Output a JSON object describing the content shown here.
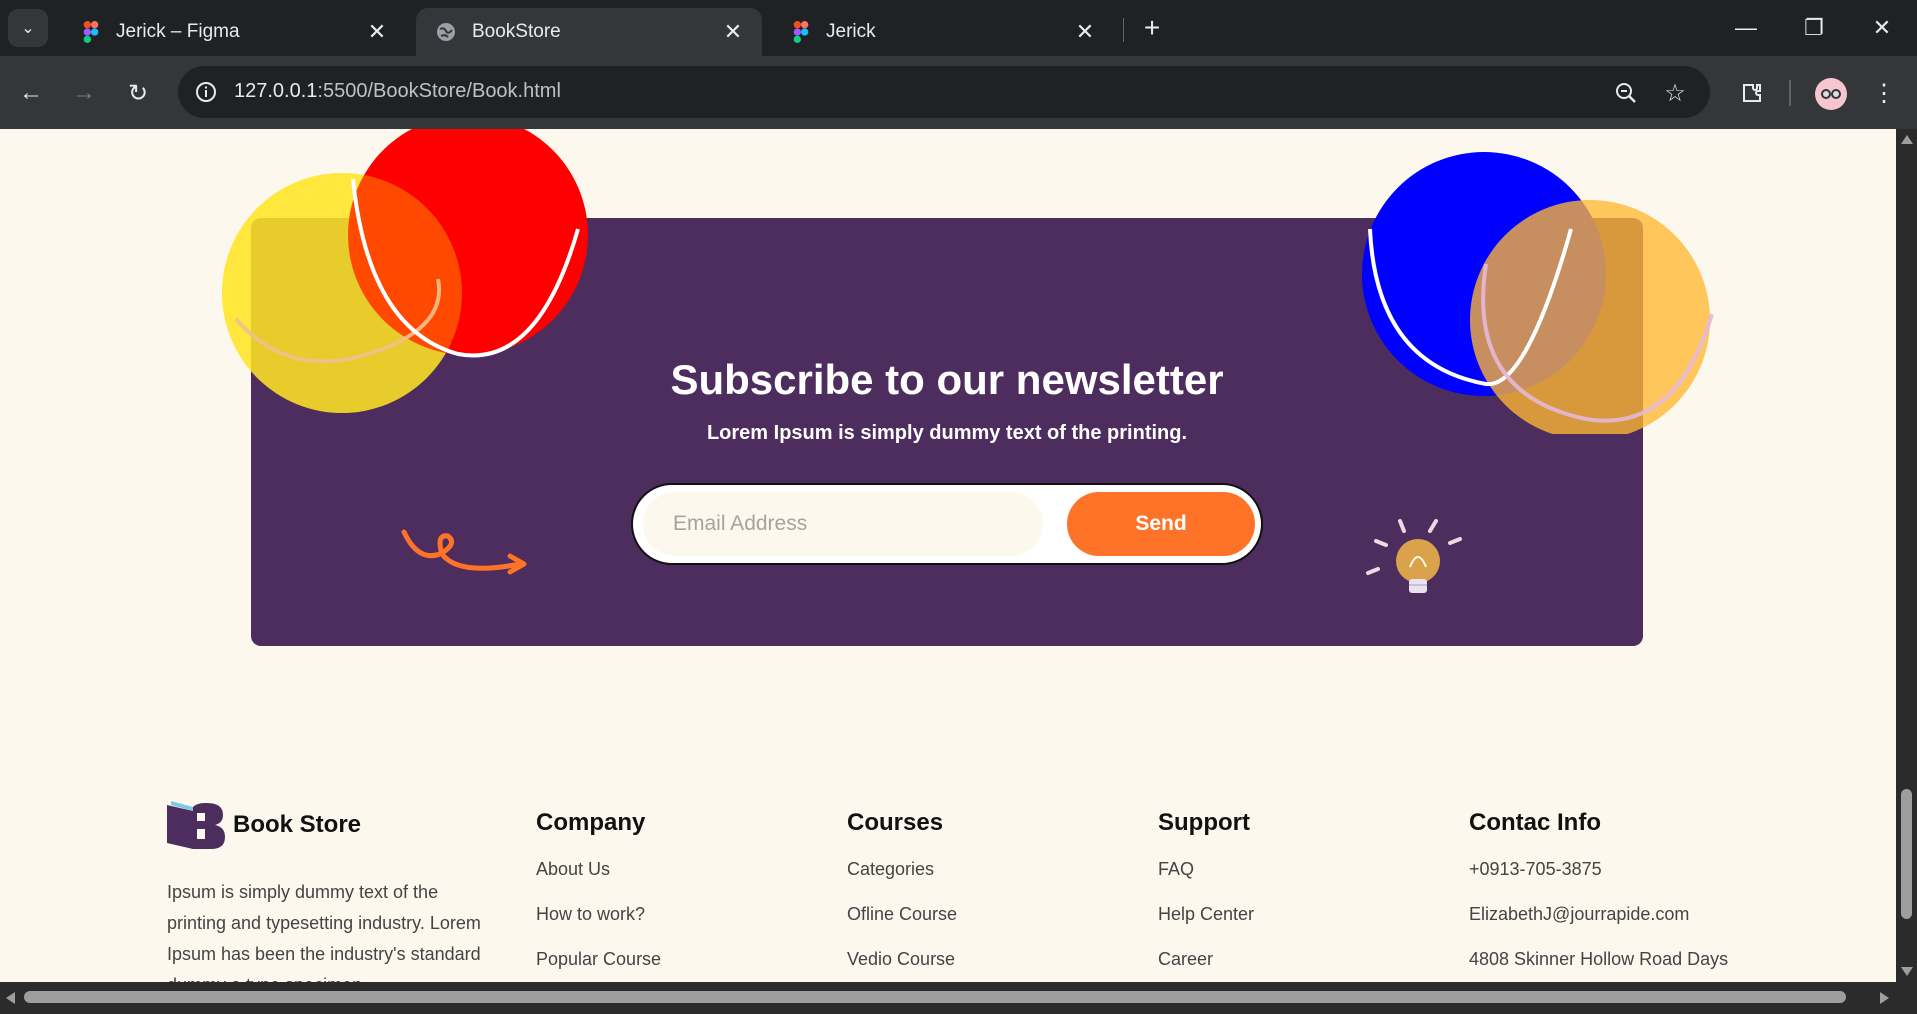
{
  "browser": {
    "tabs": [
      {
        "title": "Jerick – Figma",
        "icon": "figma-icon",
        "active": false
      },
      {
        "title": "BookStore",
        "icon": "globe-icon",
        "active": true
      },
      {
        "title": "Jerick",
        "icon": "figma-icon",
        "active": false
      }
    ],
    "url_host": "127.0.0.1",
    "url_path": ":5500/BookStore/Book.html"
  },
  "newsletter": {
    "title": "Subscribe to our newsletter",
    "subtitle": "Lorem Ipsum is simply dummy text of the printing.",
    "email_placeholder": "Email Address",
    "email_value": "",
    "send_label": "Send"
  },
  "footer": {
    "brand": {
      "name": "Book Store",
      "description": "Ipsum is simply dummy text of the printing and typesetting industry. Lorem Ipsum has been the industry's standard dummy a type specimen"
    },
    "columns": [
      {
        "heading": "Company",
        "links": [
          "About Us",
          "How to work?",
          "Popular Course"
        ]
      },
      {
        "heading": "Courses",
        "links": [
          "Categories",
          "Ofline Course",
          "Vedio Course"
        ]
      },
      {
        "heading": "Support",
        "links": [
          "FAQ",
          "Help Center",
          "Career"
        ]
      },
      {
        "heading": "Contac Info",
        "links": [
          "+0913-705-3875",
          "ElizabethJ@jourrapide.com",
          "4808 Skinner Hollow Road Days"
        ]
      }
    ]
  },
  "colors": {
    "page_bg": "#fdf8ee",
    "newsletter_bg": "#4d2c5e",
    "accent": "#ff7329"
  }
}
